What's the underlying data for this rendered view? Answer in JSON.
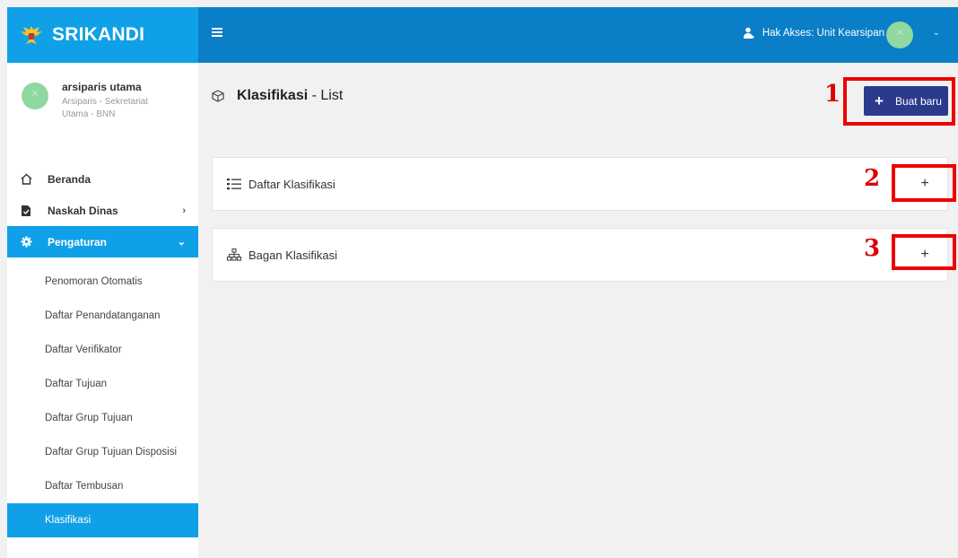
{
  "brand": {
    "name": "SRIKANDI"
  },
  "user": {
    "name": "arsiparis utama",
    "role": "Arsiparis - Sekretariat Utama - BNN"
  },
  "menu": {
    "beranda": "Beranda",
    "naskah_dinas": "Naskah Dinas",
    "pengaturan": "Pengaturan",
    "arrow_right": "›",
    "arrow_down": "⌄"
  },
  "submenu": [
    "Penomoran Otomatis",
    "Daftar Penandatanganan",
    "Daftar Verifikator",
    "Daftar Tujuan",
    "Daftar Grup Tujuan",
    "Daftar Grup Tujuan Disposisi",
    "Daftar Tembusan",
    "Klasifikasi"
  ],
  "topbar": {
    "access_label": "Hak Akses: Unit Kearsipan",
    "caret": "⌄"
  },
  "page": {
    "title_main": "Klasifikasi",
    "title_sub": " - List"
  },
  "buttons": {
    "new_plus": "+",
    "new_label": "Buat baru",
    "toggle": "+"
  },
  "panels": [
    {
      "label": "Daftar Klasifikasi"
    },
    {
      "label": "Bagan Klasifikasi"
    }
  ],
  "annotations": [
    "1",
    "2",
    "3"
  ],
  "colors": {
    "primary": "#10a0e8",
    "topbar": "#0a7ec7",
    "button": "#2c3a8c",
    "annotation": "#ee0000"
  }
}
